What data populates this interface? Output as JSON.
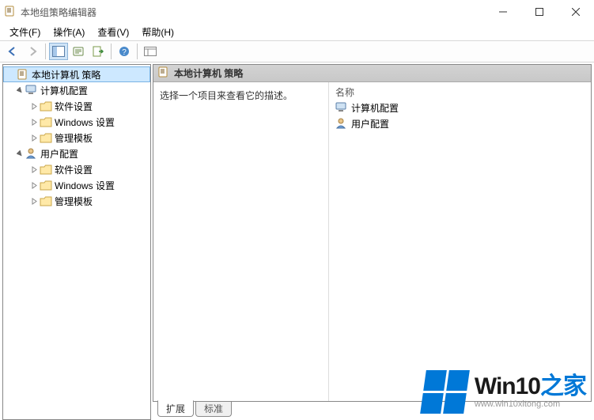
{
  "window": {
    "title": "本地组策略编辑器"
  },
  "menu": {
    "file": "文件(F)",
    "action": "操作(A)",
    "view": "查看(V)",
    "help": "帮助(H)"
  },
  "toolbar": {
    "back_icon": "back-arrow",
    "forward_icon": "forward-arrow",
    "panes_icon": "split-panes",
    "props_icon": "properties",
    "export_icon": "export-list",
    "help_icon": "help",
    "extra_icon": "detail-view"
  },
  "tree": {
    "root": {
      "label": "本地计算机 策略"
    },
    "computer": {
      "label": "计算机配置",
      "children": {
        "software": "软件设置",
        "windows": "Windows 设置",
        "admin": "管理模板"
      }
    },
    "user": {
      "label": "用户配置",
      "children": {
        "software": "软件设置",
        "windows": "Windows 设置",
        "admin": "管理模板"
      }
    }
  },
  "content": {
    "header": "本地计算机 策略",
    "description": "选择一个项目来查看它的描述。",
    "columns": {
      "name": "名称"
    },
    "items": [
      {
        "label": "计算机配置",
        "icon": "computer-config"
      },
      {
        "label": "用户配置",
        "icon": "user-config"
      }
    ],
    "tabs": {
      "extended": "扩展",
      "standard": "标准"
    }
  },
  "watermark": {
    "brand_main": "Win10",
    "brand_suffix": "之家",
    "url": "www.win10xitong.com"
  }
}
